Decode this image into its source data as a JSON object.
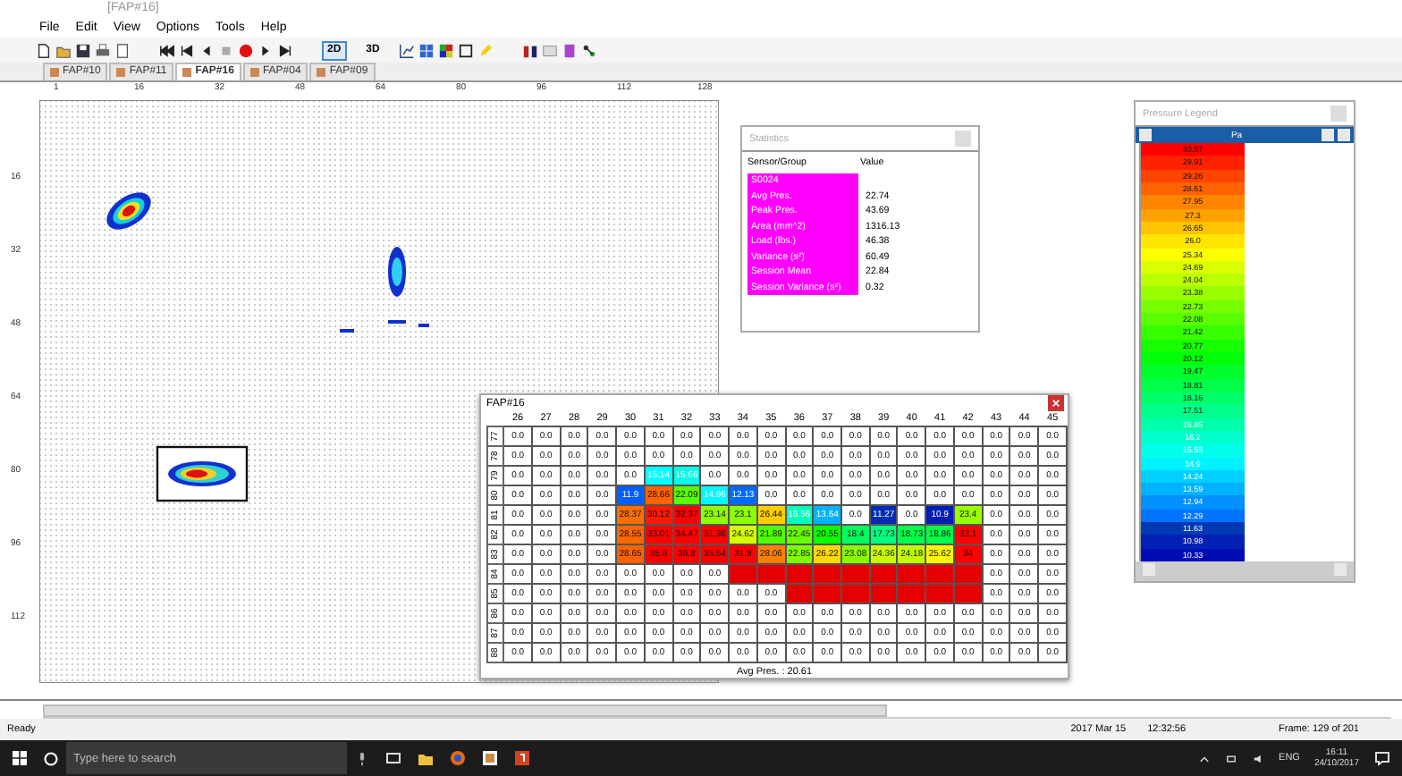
{
  "window": {
    "title": "[FAP#16]"
  },
  "menu": [
    "File",
    "Edit",
    "View",
    "Options",
    "Tools",
    "Help"
  ],
  "toolbar": {
    "view_buttons": [
      "2D",
      "3D"
    ]
  },
  "tabs": [
    {
      "label": "FAP#10",
      "selected": false
    },
    {
      "label": "FAP#11",
      "selected": false
    },
    {
      "label": "FAP#16",
      "selected": true
    },
    {
      "label": "FAP#04",
      "selected": false
    },
    {
      "label": "FAP#09",
      "selected": false
    }
  ],
  "canvas": {
    "top_ruler": [
      "1",
      "16",
      "32",
      "48",
      "64",
      "80",
      "96",
      "112",
      "128"
    ],
    "left_ruler": [
      "16",
      "32",
      "48",
      "64",
      "80",
      "96",
      "112"
    ]
  },
  "statistics": {
    "title": "Statistics",
    "columns": [
      "Sensor/Group",
      "Value"
    ],
    "rows": [
      {
        "label": "S0024"
      },
      {
        "label": "Avg Pres.",
        "value": "22.74"
      },
      {
        "label": "Peak Pres.",
        "value": "43.69"
      },
      {
        "label": "Area (mm^2)",
        "value": "1316.13"
      },
      {
        "label": "Load (lbs.)",
        "value": "46.38"
      },
      {
        "label": "Variance (s²)",
        "value": "60.49"
      },
      {
        "label": "Session Mean",
        "value": "22.84"
      },
      {
        "label": "Session Variance (s²)",
        "value": "0.32"
      }
    ]
  },
  "legend": {
    "title": "Pressure Legend",
    "unit": "Pa",
    "values": [
      "30.57",
      "29.91",
      "29.26",
      "28.61",
      "27.95",
      "27.3",
      "26.65",
      "26.0",
      "25.34",
      "24.69",
      "24.04",
      "23.38",
      "22.73",
      "22.08",
      "21.42",
      "20.77",
      "20.12",
      "19.47",
      "18.81",
      "18.16",
      "17.51",
      "16.85",
      "16.2",
      "15.55",
      "14.9",
      "14.24",
      "13.59",
      "12.94",
      "12.29",
      "11.63",
      "10.98",
      "10.33"
    ]
  },
  "grid_panel": {
    "title": "FAP#16",
    "columns": [
      "26",
      "27",
      "28",
      "29",
      "30",
      "31",
      "32",
      "33",
      "34",
      "35",
      "36",
      "37",
      "38",
      "39",
      "40",
      "41",
      "42",
      "43",
      "44",
      "45"
    ],
    "rows": [
      {
        "label": "77",
        "cells": [
          "0.0",
          "0.0",
          "0.0",
          "0.0",
          "0.0",
          "0.0",
          "0.0",
          "0.0",
          "0.0",
          "0.0",
          "0.0",
          "0.0",
          "0.0",
          "0.0",
          "0.0",
          "0.0",
          "0.0",
          "0.0",
          "0.0",
          "0.0"
        ]
      },
      {
        "label": "78",
        "cells": [
          "0.0",
          "0.0",
          "0.0",
          "0.0",
          "0.0",
          "0.0",
          "0.0",
          "0.0",
          "0.0",
          "0.0",
          "0.0",
          "0.0",
          "0.0",
          "0.0",
          "0.0",
          "0.0",
          "0.0",
          "0.0",
          "0.0",
          "0.0"
        ]
      },
      {
        "label": "79",
        "cells": [
          "0.0",
          "0.0",
          "0.0",
          "0.0",
          "0.0",
          "15.14",
          "15.66",
          "0.0",
          "0.0",
          "0.0",
          "0.0",
          "0.0",
          "0.0",
          "0.0",
          "0.0",
          "0.0",
          "0.0",
          "0.0",
          "0.0",
          "0.0"
        ]
      },
      {
        "label": "80",
        "cells": [
          "0.0",
          "0.0",
          "0.0",
          "0.0",
          "11.9",
          "28.66",
          "22.09",
          "14.96",
          "12.13",
          "0.0",
          "0.0",
          "0.0",
          "0.0",
          "0.0",
          "0.0",
          "0.0",
          "0.0",
          "0.0",
          "0.0",
          "0.0"
        ]
      },
      {
        "label": "81",
        "cells": [
          "0.0",
          "0.0",
          "0.0",
          "0.0",
          "28.37",
          "30.12",
          "32.37",
          "23.14",
          "23.1",
          "26.44",
          "16.56",
          "13.64",
          "0.0",
          "11.27",
          "0.0",
          "10.9",
          "23.4",
          "0.0",
          "0.0",
          "0.0"
        ]
      },
      {
        "label": "82",
        "cells": [
          "0.0",
          "0.0",
          "0.0",
          "0.0",
          "28.55",
          "33.01",
          "34.47",
          "31.36",
          "24.62",
          "21.89",
          "22.45",
          "20.55",
          "18.4",
          "17.73",
          "18.73",
          "18.86",
          "32.1",
          "0.0",
          "0.0",
          "0.0"
        ]
      },
      {
        "label": "83",
        "cells": [
          "0.0",
          "0.0",
          "0.0",
          "0.0",
          "28.65",
          "35.6",
          "36.8",
          "35.54",
          "31.9",
          "28.06",
          "22.85",
          "26.22",
          "23.08",
          "24.36",
          "24.18",
          "25.62",
          "34",
          "0.0",
          "0.0",
          "0.0"
        ]
      },
      {
        "label": "84",
        "cells": [
          "0.0",
          "0.0",
          "0.0",
          "0.0",
          "0.0",
          "0.0",
          "0.0",
          "0.0",
          null,
          null,
          null,
          null,
          null,
          null,
          null,
          null,
          null,
          "0.0",
          "0.0",
          "0.0"
        ]
      },
      {
        "label": "85",
        "cells": [
          "0.0",
          "0.0",
          "0.0",
          "0.0",
          "0.0",
          "0.0",
          "0.0",
          "0.0",
          "0.0",
          "0.0",
          null,
          null,
          null,
          null,
          null,
          null,
          null,
          "0.0",
          "0.0",
          "0.0"
        ]
      },
      {
        "label": "86",
        "cells": [
          "0.0",
          "0.0",
          "0.0",
          "0.0",
          "0.0",
          "0.0",
          "0.0",
          "0.0",
          "0.0",
          "0.0",
          "0.0",
          "0.0",
          "0.0",
          "0.0",
          "0.0",
          "0.0",
          "0.0",
          "0.0",
          "0.0",
          "0.0"
        ]
      },
      {
        "label": "87",
        "cells": [
          "0.0",
          "0.0",
          "0.0",
          "0.0",
          "0.0",
          "0.0",
          "0.0",
          "0.0",
          "0.0",
          "0.0",
          "0.0",
          "0.0",
          "0.0",
          "0.0",
          "0.0",
          "0.0",
          "0.0",
          "0.0",
          "0.0",
          "0.0"
        ]
      },
      {
        "label": "88",
        "cells": [
          "0.0",
          "0.0",
          "0.0",
          "0.0",
          "0.0",
          "0.0",
          "0.0",
          "0.0",
          "0.0",
          "0.0",
          "0.0",
          "0.0",
          "0.0",
          "0.0",
          "0.0",
          "0.0",
          "0.0",
          "0.0",
          "0.0",
          "0.0"
        ]
      }
    ],
    "footer": "Avg Pres. : 20.61"
  },
  "status_bar": {
    "status": "Ready",
    "date": "2017 Mar 15",
    "time": "12:32:56",
    "frame": "Frame: 129 of 201"
  },
  "taskbar": {
    "search_placeholder": "Type here to search",
    "language": "ENG",
    "clock_time": "16:11",
    "clock_date": "24/10/2017"
  }
}
